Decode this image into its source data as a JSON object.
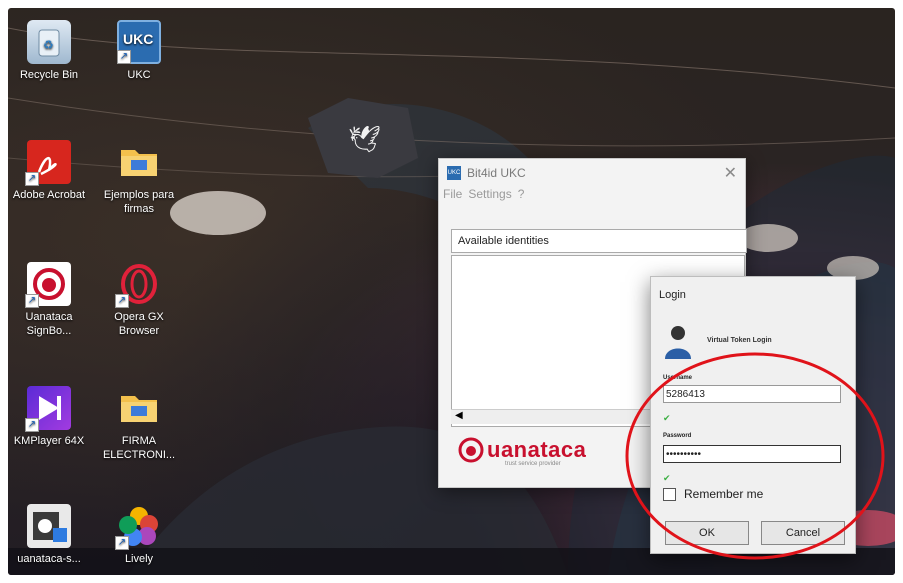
{
  "desktop": {
    "icons": [
      {
        "label": "Recycle Bin",
        "icon": "recycle-bin-icon"
      },
      {
        "label": "UKC",
        "icon": "ukc-icon"
      },
      {
        "label": "Adobe Acrobat",
        "icon": "adobe-acrobat-icon"
      },
      {
        "label": "Ejemplos para firmas",
        "icon": "folder-icon"
      },
      {
        "label": "Uanataca SignBo...",
        "icon": "uanataca-signbox-icon"
      },
      {
        "label": "Opera GX Browser",
        "icon": "opera-gx-icon"
      },
      {
        "label": "KMPlayer 64X",
        "icon": "kmplayer-icon"
      },
      {
        "label": "FIRMA ELECTRONI...",
        "icon": "folder-icon"
      },
      {
        "label": "uanataca-s...",
        "icon": "uanataca-setup-icon"
      },
      {
        "label": "Lively",
        "icon": "lively-icon"
      }
    ],
    "icon_names": {
      "ukc_badge": "UKC"
    }
  },
  "ukc_window": {
    "title": "Bit4id UKC",
    "menu": [
      "File",
      "Settings",
      "?"
    ],
    "identities_header": "Available identities",
    "brand": "uanataca",
    "brand_tagline": "trust service provider"
  },
  "login_dialog": {
    "title": "Login",
    "subtitle": "Virtual Token Login",
    "username_label": "Username",
    "username_value": "5286413",
    "password_label": "Password",
    "password_value": "••••••••••",
    "remember_label": "Remember me",
    "ok_label": "OK",
    "cancel_label": "Cancel"
  },
  "colors": {
    "highlight": "#e0131a",
    "brand_red": "#c8102e",
    "check_green": "#3cb043"
  }
}
